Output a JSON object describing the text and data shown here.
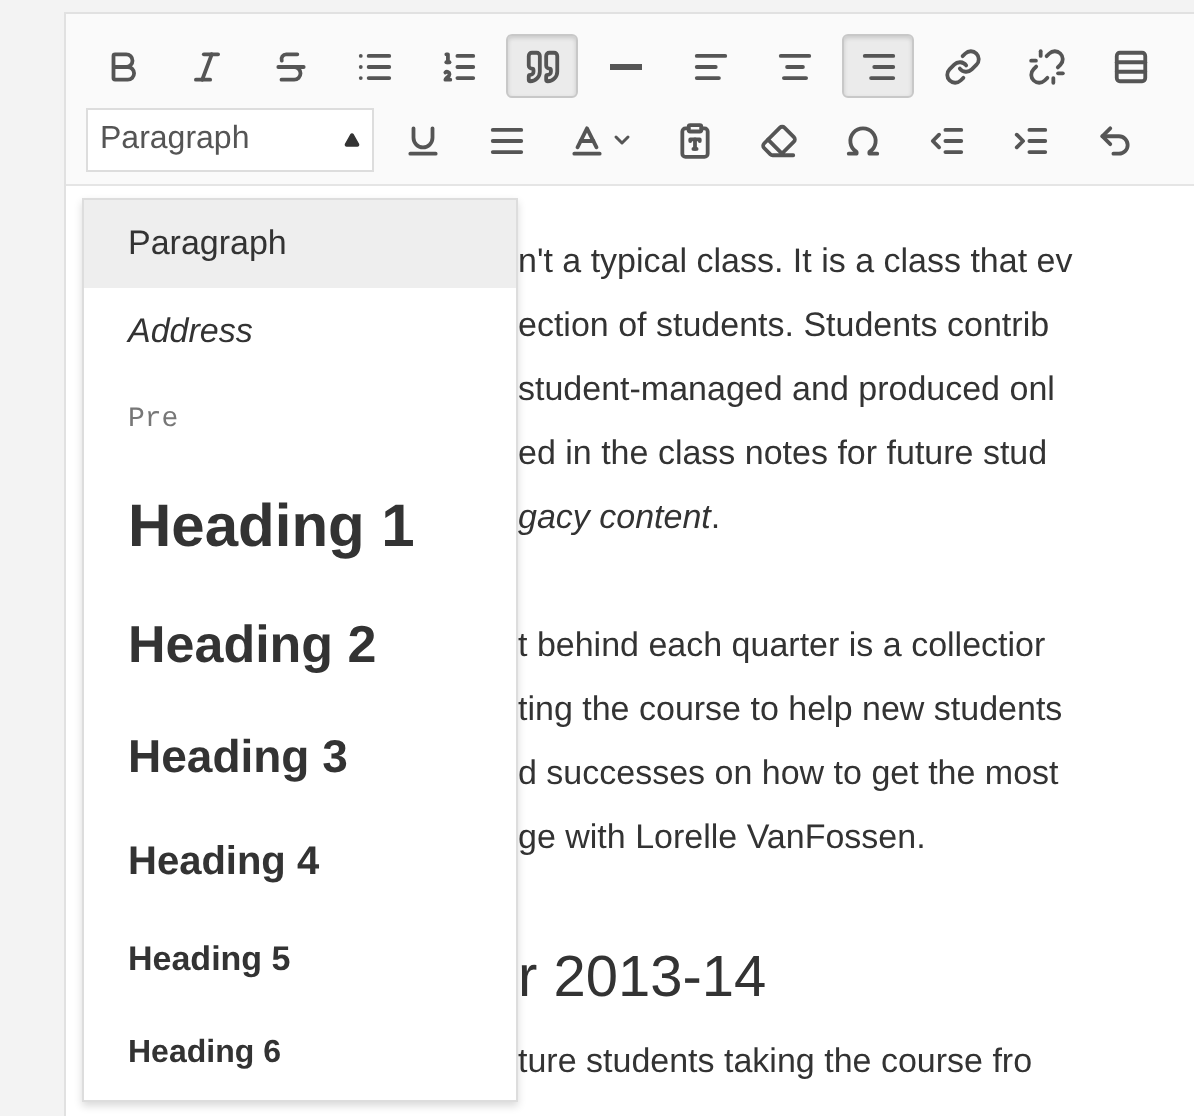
{
  "toolbar_rows": [
    [
      {
        "kind": "bold",
        "selected": false
      },
      {
        "kind": "italic",
        "selected": false
      },
      {
        "kind": "strikethrough",
        "selected": false
      },
      {
        "kind": "bullet-list",
        "selected": false
      },
      {
        "kind": "numbered-list",
        "selected": false
      },
      {
        "kind": "blockquote",
        "selected": true
      },
      {
        "kind": "horizontal-rule",
        "selected": false
      },
      {
        "kind": "align-left",
        "selected": false
      },
      {
        "kind": "align-center",
        "selected": false
      },
      {
        "kind": "align-right",
        "selected": true
      },
      {
        "kind": "link",
        "selected": false
      },
      {
        "kind": "unlink",
        "selected": false
      },
      {
        "kind": "toolbar-toggle",
        "selected": false
      }
    ],
    [
      {
        "kind": "underline",
        "selected": false
      },
      {
        "kind": "justify",
        "selected": false
      },
      {
        "kind": "text-color",
        "selected": false
      },
      {
        "kind": "paste-text",
        "selected": false
      },
      {
        "kind": "clear-format",
        "selected": false
      },
      {
        "kind": "special-char",
        "selected": false
      },
      {
        "kind": "outdent",
        "selected": false
      },
      {
        "kind": "indent",
        "selected": false
      },
      {
        "kind": "undo",
        "selected": false
      }
    ]
  ],
  "format_select": {
    "value": "Paragraph",
    "expanded": true
  },
  "format_menu": [
    {
      "label": "Paragraph",
      "kind": "p",
      "selected": true
    },
    {
      "label": "Address",
      "kind": "address",
      "selected": false
    },
    {
      "label": "Pre",
      "kind": "pre",
      "selected": false
    },
    {
      "label": "Heading 1",
      "kind": "h1",
      "selected": false
    },
    {
      "label": "Heading 2",
      "kind": "h2",
      "selected": false
    },
    {
      "label": "Heading 3",
      "kind": "h3",
      "selected": false
    },
    {
      "label": "Heading 4",
      "kind": "h4",
      "selected": false
    },
    {
      "label": "Heading 5",
      "kind": "h5",
      "selected": false
    },
    {
      "label": "Heading 6",
      "kind": "h6",
      "selected": false
    }
  ],
  "content": [
    {
      "kind": "paragraph",
      "lines": [
        "n't a typical class. It is a class that ev",
        "ection of students. Students contrib",
        "student-managed and produced onl",
        "ed in the class notes for future stud",
        "*gacy content*."
      ]
    },
    {
      "kind": "paragraph",
      "lines": [
        "t behind each quarter is a collectior",
        "ting the course to help new students",
        "d successes on how to get the most",
        "ge with Lorelle VanFossen."
      ]
    },
    {
      "kind": "heading",
      "lines": [
        "r 2013-14"
      ]
    },
    {
      "kind": "paragraph",
      "lines": [
        "ture students taking the course fro"
      ]
    }
  ]
}
